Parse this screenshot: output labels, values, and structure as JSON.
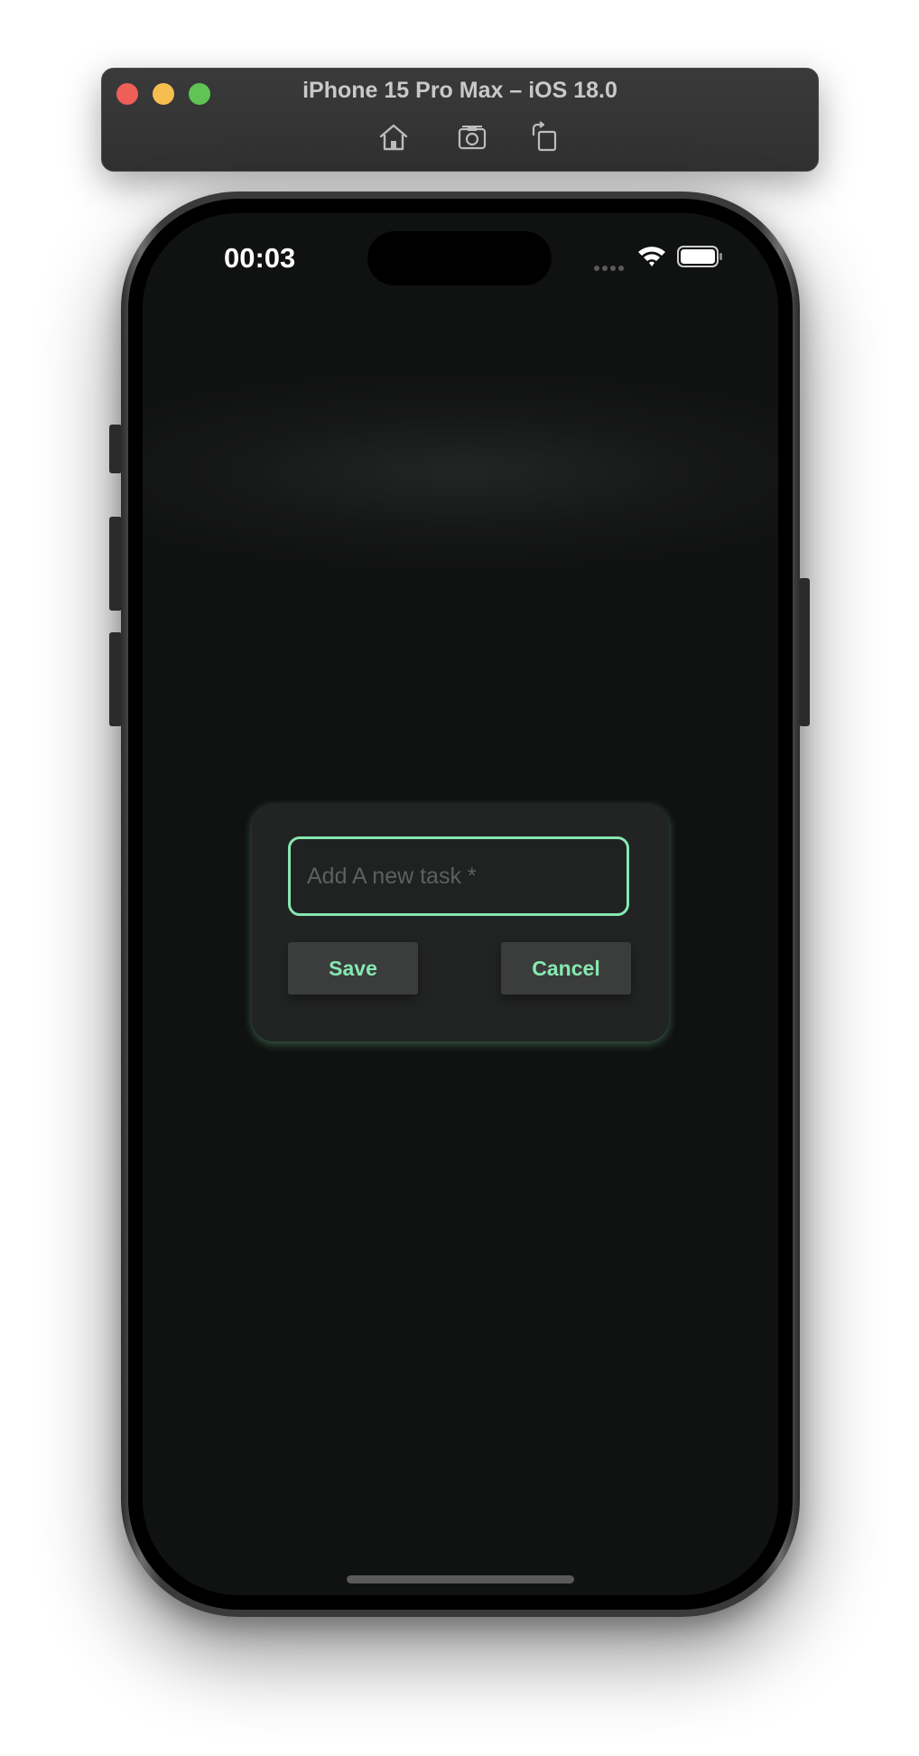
{
  "simulator": {
    "title": "iPhone 15 Pro Max – iOS 18.0",
    "tools": [
      "home-icon",
      "screenshot-icon",
      "rotate-icon"
    ]
  },
  "status_bar": {
    "time": "00:03",
    "icons": [
      "cellular-dots-icon",
      "wifi-icon",
      "battery-icon"
    ]
  },
  "dialog": {
    "input_placeholder": "Add A new task *",
    "input_value": "",
    "save_label": "Save",
    "cancel_label": "Cancel"
  },
  "colors": {
    "accent": "#86e8b0",
    "screen_background": "#101111",
    "dialog_background": "#222323",
    "button_background": "#3b3c3c"
  }
}
